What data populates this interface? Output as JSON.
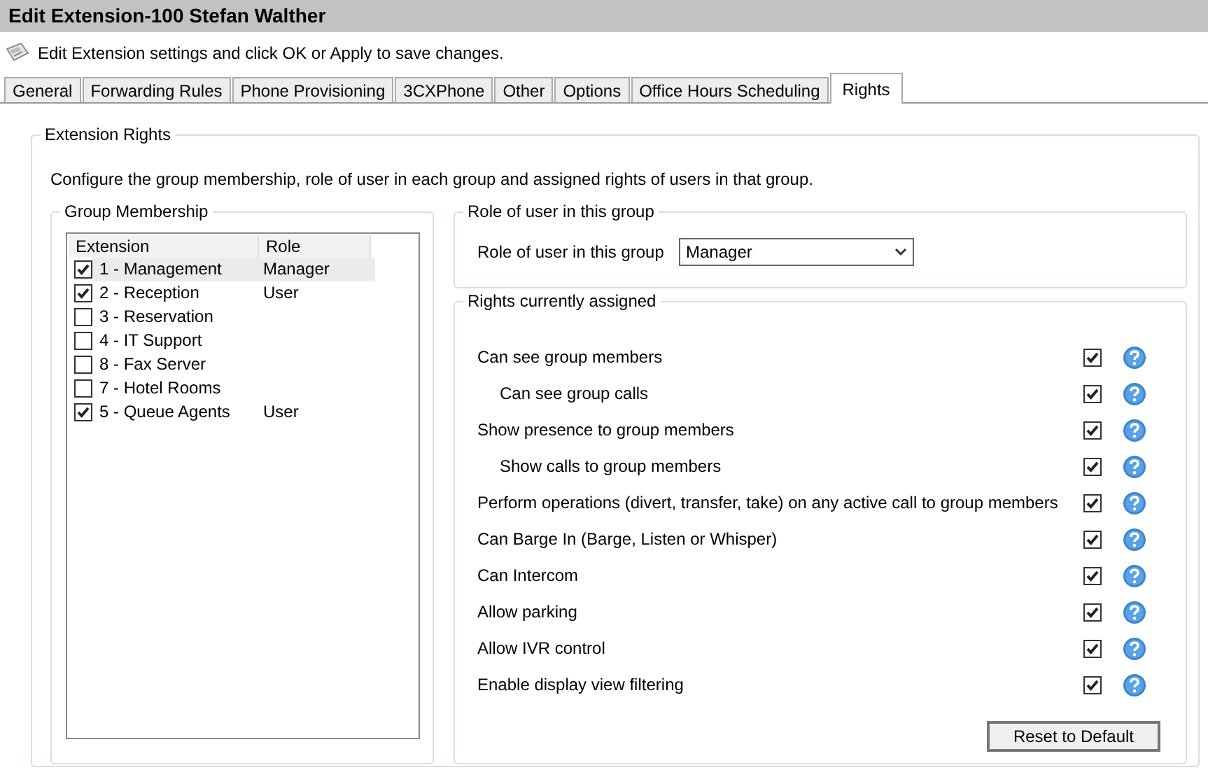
{
  "window": {
    "title": "Edit Extension-100 Stefan Walther"
  },
  "hint": "Edit Extension settings and click OK or Apply to save changes.",
  "tabs": [
    {
      "label": "General",
      "selected": false
    },
    {
      "label": "Forwarding Rules",
      "selected": false
    },
    {
      "label": "Phone Provisioning",
      "selected": false
    },
    {
      "label": "3CXPhone",
      "selected": false
    },
    {
      "label": "Other",
      "selected": false
    },
    {
      "label": "Options",
      "selected": false
    },
    {
      "label": "Office Hours Scheduling",
      "selected": false
    },
    {
      "label": "Rights",
      "selected": true
    }
  ],
  "extension_rights": {
    "title": "Extension Rights",
    "description": "Configure the group membership, role of user in each group and assigned rights of users in that group.",
    "group_membership": {
      "title": "Group Membership",
      "columns": [
        "Extension",
        "Role"
      ],
      "rows": [
        {
          "extension": "1 - Management",
          "role": "Manager",
          "checked": true,
          "selected": true
        },
        {
          "extension": "2 - Reception",
          "role": "User",
          "checked": true,
          "selected": false
        },
        {
          "extension": "3 - Reservation",
          "checked": false,
          "selected": false
        },
        {
          "extension": "4 - IT Support",
          "checked": false,
          "selected": false
        },
        {
          "extension": "8 - Fax Server",
          "checked": false,
          "selected": false
        },
        {
          "extension": "7 - Hotel Rooms",
          "checked": false,
          "selected": false
        },
        {
          "extension": "5 - Queue Agents",
          "role": "User",
          "checked": true,
          "selected": false
        }
      ]
    },
    "role": {
      "title": "Role of user in this group",
      "label": "Role of user in this group",
      "value": "Manager"
    },
    "rights": {
      "title": "Rights currently assigned",
      "items": [
        {
          "label": "Can see group members",
          "checked": true,
          "children": [
            {
              "label": "Can see group calls",
              "checked": true
            }
          ]
        },
        {
          "label": "Show presence to group members",
          "checked": true,
          "children": [
            {
              "label": "Show calls to group members",
              "checked": true
            }
          ]
        },
        {
          "label": "Perform operations (divert, transfer, take) on any active call to group members",
          "checked": true
        },
        {
          "label": "Can Barge In (Barge, Listen or Whisper)",
          "checked": true
        },
        {
          "label": "Can Intercom",
          "checked": true
        },
        {
          "label": "Allow parking",
          "checked": true
        },
        {
          "label": "Allow IVR control",
          "checked": true
        },
        {
          "label": "Enable display view filtering",
          "checked": true
        }
      ],
      "reset_button": "Reset to Default"
    }
  }
}
